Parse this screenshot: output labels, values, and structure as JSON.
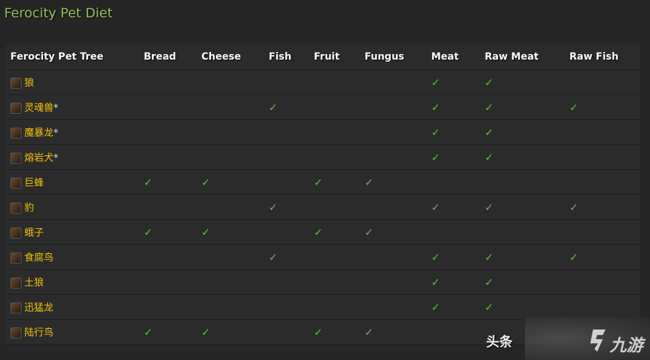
{
  "title": "Ferocity Pet Diet",
  "columns": [
    "Ferocity Pet Tree",
    "Bread",
    "Cheese",
    "Fish",
    "Fruit",
    "Fungus",
    "Meat",
    "Raw Meat",
    "Raw Fish"
  ],
  "check_color": "#5fc04a",
  "rows": [
    {
      "name": "狼",
      "star": "",
      "diet": [
        0,
        0,
        0,
        0,
        0,
        1,
        1,
        0
      ]
    },
    {
      "name": "灵魂兽",
      "star": "*",
      "diet": [
        0,
        0,
        1,
        0,
        0,
        1,
        1,
        1
      ]
    },
    {
      "name": "魔暴龙",
      "star": "*",
      "diet": [
        0,
        0,
        0,
        0,
        0,
        1,
        1,
        0
      ]
    },
    {
      "name": "熔岩犬",
      "star": "*",
      "diet": [
        0,
        0,
        0,
        0,
        0,
        1,
        1,
        0
      ]
    },
    {
      "name": "巨蜂",
      "star": "",
      "diet": [
        1,
        1,
        0,
        1,
        1,
        0,
        0,
        0
      ]
    },
    {
      "name": "豹",
      "star": "",
      "diet": [
        0,
        0,
        1,
        0,
        0,
        1,
        1,
        1
      ]
    },
    {
      "name": "蛾子",
      "star": "",
      "diet": [
        1,
        1,
        0,
        1,
        1,
        0,
        0,
        0
      ]
    },
    {
      "name": "食腐鸟",
      "star": "",
      "diet": [
        0,
        0,
        1,
        0,
        0,
        1,
        1,
        1
      ]
    },
    {
      "name": "土狼",
      "star": "",
      "diet": [
        0,
        0,
        0,
        0,
        0,
        1,
        1,
        0
      ]
    },
    {
      "name": "迅猛龙",
      "star": "",
      "diet": [
        0,
        0,
        0,
        0,
        0,
        1,
        1,
        0
      ]
    },
    {
      "name": "陆行鸟",
      "star": "",
      "diet": [
        1,
        1,
        0,
        1,
        1,
        0,
        0,
        0
      ]
    }
  ],
  "watermarks": {
    "toutiao": "头条",
    "jiuyou": "九游"
  }
}
